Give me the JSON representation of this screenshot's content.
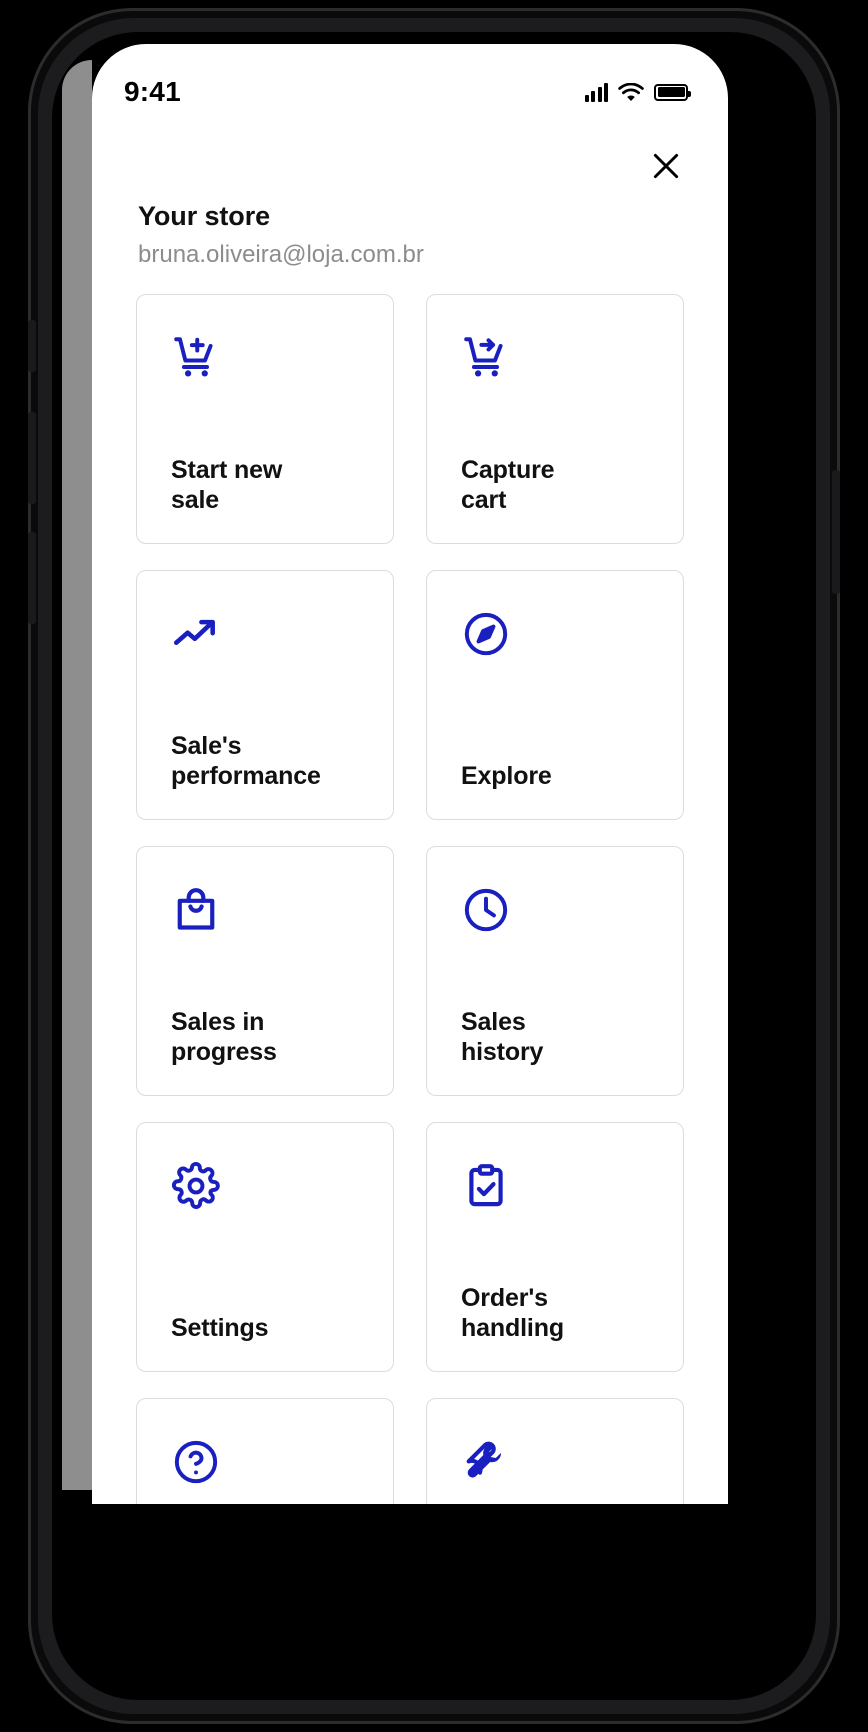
{
  "status_bar": {
    "time": "9:41",
    "signal_icon": "cellular-signal-icon",
    "wifi_icon": "wifi-icon",
    "battery_icon": "battery-full-icon"
  },
  "header": {
    "close_icon": "close-icon",
    "title": "Your store",
    "email": "bruna.oliveira@loja.com.br"
  },
  "theme": {
    "icon_color": "#1a20c0",
    "accent": "#1a20c0",
    "tile_border": "#dcdcdc",
    "title_color": "#111111",
    "email_color": "#8c8c8c",
    "screen_background": "#ffffff",
    "device_background": "#000000"
  },
  "menu": {
    "tiles": [
      {
        "id": "start-new-sale",
        "label": "Start new\nsale",
        "icon": "cart-plus-icon"
      },
      {
        "id": "capture-cart",
        "label": "Capture\ncart",
        "icon": "cart-arrow-icon"
      },
      {
        "id": "sales-performance",
        "label": "Sale's\nperformance",
        "icon": "trending-up-icon"
      },
      {
        "id": "explore",
        "label": "Explore",
        "icon": "compass-icon"
      },
      {
        "id": "sales-in-progress",
        "label": "Sales in\nprogress",
        "icon": "shopping-bag-icon"
      },
      {
        "id": "sales-history",
        "label": "Sales\nhistory",
        "icon": "clock-icon"
      },
      {
        "id": "settings",
        "label": "Settings",
        "icon": "gear-icon"
      },
      {
        "id": "orders-handling",
        "label": "Order's\nhandling",
        "icon": "clipboard-check-icon"
      },
      {
        "id": "help",
        "label": "",
        "icon": "help-circle-icon"
      },
      {
        "id": "tools",
        "label": "",
        "icon": "wrench-icon"
      }
    ]
  }
}
